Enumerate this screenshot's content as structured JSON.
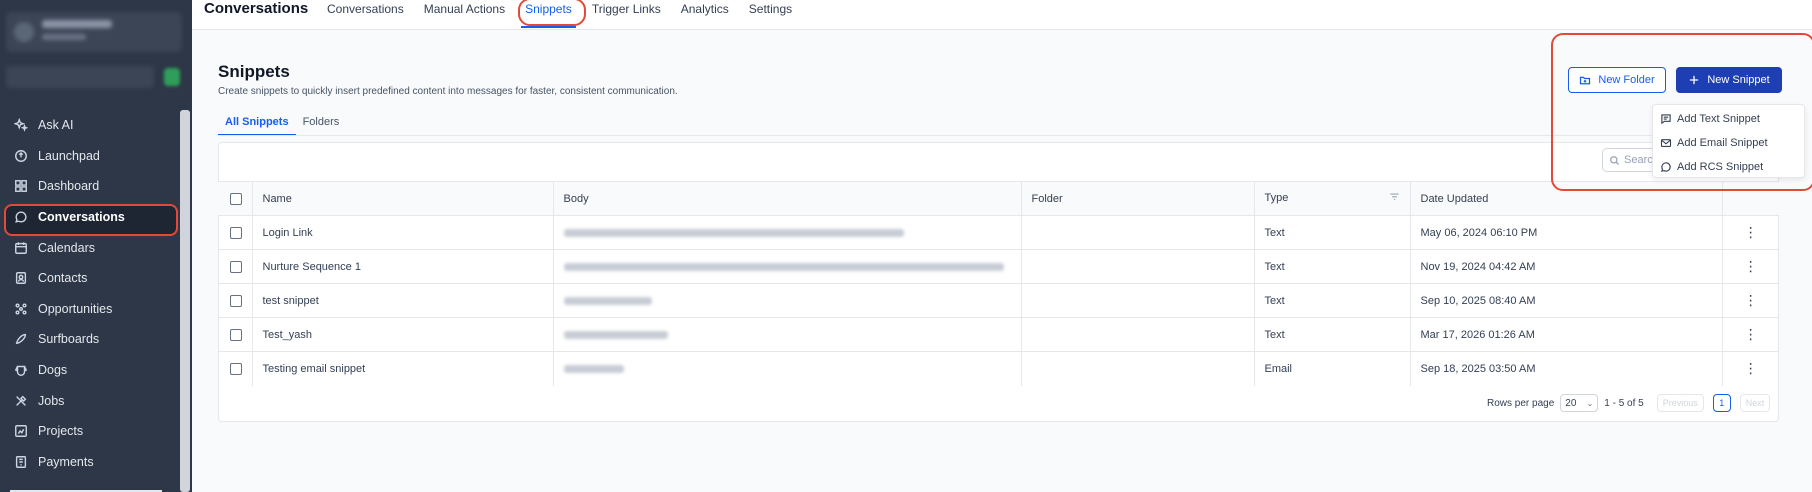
{
  "app": {
    "title": "Conversations",
    "top_tabs": [
      "Conversations",
      "Manual Actions",
      "Snippets",
      "Trigger Links",
      "Analytics",
      "Settings"
    ],
    "active_tab": "Snippets"
  },
  "sidebar": {
    "items": [
      {
        "label": "Ask AI",
        "icon": "sparkle-icon"
      },
      {
        "label": "Launchpad",
        "icon": "rocket-icon"
      },
      {
        "label": "Dashboard",
        "icon": "grid-icon"
      },
      {
        "label": "Conversations",
        "icon": "chat-bubble-icon",
        "active": true
      },
      {
        "label": "Calendars",
        "icon": "calendar-icon"
      },
      {
        "label": "Contacts",
        "icon": "contacts-icon"
      },
      {
        "label": "Opportunities",
        "icon": "opportunities-icon"
      },
      {
        "label": "Surfboards",
        "icon": "surfboard-icon"
      },
      {
        "label": "Dogs",
        "icon": "dog-icon"
      },
      {
        "label": "Jobs",
        "icon": "tools-icon"
      },
      {
        "label": "Projects",
        "icon": "projects-icon"
      },
      {
        "label": "Payments",
        "icon": "payments-icon"
      }
    ]
  },
  "page": {
    "title": "Snippets",
    "subtitle": "Create snippets to quickly insert predefined content into messages for faster, consistent communication.",
    "sub_tabs": [
      "All Snippets",
      "Folders"
    ],
    "search_placeholder": "Search"
  },
  "actions": {
    "new_folder": "New Folder",
    "new_snippet": "New Snippet",
    "menu": [
      "Add Text Snippet",
      "Add Email Snippet",
      "Add RCS Snippet"
    ]
  },
  "table": {
    "columns": [
      "Name",
      "Body",
      "Folder",
      "Type",
      "Date Updated"
    ],
    "rows": [
      {
        "name": "Login Link",
        "type": "Text",
        "date": "May 06, 2024 06:10 PM"
      },
      {
        "name": "Nurture Sequence 1",
        "type": "Text",
        "date": "Nov 19, 2024 04:42 AM"
      },
      {
        "name": "test snippet",
        "type": "Text",
        "date": "Sep 10, 2025 08:40 AM"
      },
      {
        "name": "Test_yash",
        "type": "Text",
        "date": "Mar 17, 2026 01:26 AM"
      },
      {
        "name": "Testing email snippet",
        "type": "Email",
        "date": "Sep 18, 2025 03:50 AM"
      }
    ]
  },
  "pagination": {
    "rows_per_page_label": "Rows per page",
    "rows_per_page": "20",
    "range": "1 - 5 of 5",
    "previous": "Previous",
    "page": "1",
    "next": "Next"
  },
  "colors": {
    "accent": "#155eef",
    "primary_button": "#1d3fb3",
    "sidebar": "#2d3748",
    "annotation": "#e04a36"
  }
}
